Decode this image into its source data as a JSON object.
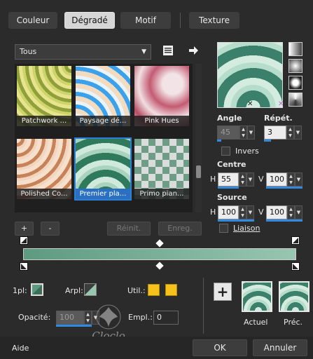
{
  "tabs": [
    {
      "label": "Couleur",
      "active": false
    },
    {
      "label": "Dégradé",
      "active": true
    },
    {
      "label": "Motif",
      "active": false
    },
    {
      "label": "Texture",
      "active": false
    }
  ],
  "category_dropdown": {
    "value": "Tous"
  },
  "gallery": {
    "items": [
      {
        "label": "Patchwork ...",
        "selected": false
      },
      {
        "label": "Paysage dé...",
        "selected": false
      },
      {
        "label": "Pink Hues",
        "selected": false
      },
      {
        "label": "Polished Co...",
        "selected": false
      },
      {
        "label": "Premier pla...",
        "selected": true
      },
      {
        "label": "Primo pian...",
        "selected": false
      }
    ]
  },
  "gallery_buttons": {
    "add": "+",
    "remove": "-",
    "reset": "Réinit.",
    "save": "Enreg."
  },
  "angle": {
    "label": "Angle",
    "value": "45"
  },
  "repeat": {
    "label": "Répét.",
    "value": "3"
  },
  "invert": {
    "label": "Invers",
    "checked": false
  },
  "center": {
    "label": "Centre",
    "h_label": "H",
    "h_value": "55",
    "v_label": "V",
    "v_value": "100"
  },
  "source": {
    "label": "Source",
    "h_label": "H",
    "h_value": "100",
    "v_label": "V",
    "v_value": "100"
  },
  "link": {
    "label": "Liaison",
    "checked": false
  },
  "bottom": {
    "foreground_label": "1pl:",
    "background_label": "Arpl:",
    "util_label": "Util.:",
    "opacity_label": "Opacité:",
    "opacity_value": "100",
    "empl_label": "Empl.:",
    "empl_value": "0",
    "current_label": "Actuel",
    "previous_label": "Préc."
  },
  "footer": {
    "help": "Aide",
    "ok": "OK",
    "cancel": "Annuler"
  },
  "watermark": "Cloclo",
  "colors": {
    "accent": "#2b7fd6",
    "gradient_dark": "#2f6f55",
    "gradient_light": "#c8e6d8",
    "util_swatch": "#f4c21a"
  }
}
